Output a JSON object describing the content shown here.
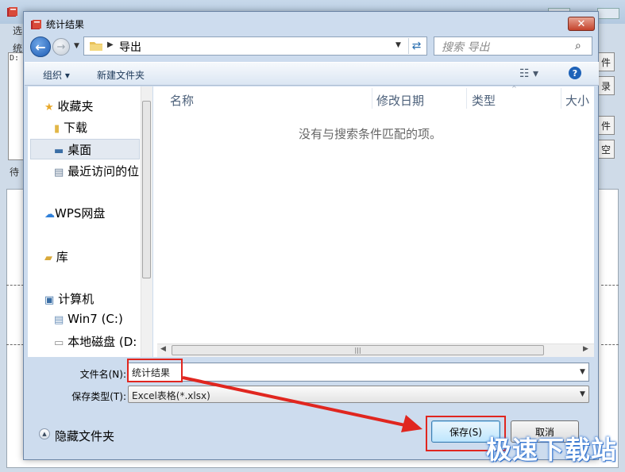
{
  "background_app": {
    "menu_label": "选",
    "side_tab": "统",
    "panel_text": "D:",
    "status_label": "待",
    "side_buttons": [
      "件",
      "录",
      "件",
      "空"
    ]
  },
  "dialog": {
    "title": "统计结果",
    "close_symbol": "✕"
  },
  "nav": {
    "back_symbol": "←",
    "forward_symbol": "→",
    "address_segment": "导出",
    "search_placeholder": "搜索 导出"
  },
  "toolbar": {
    "organize_label": "组织 ▾",
    "new_folder_label": "新建文件夹",
    "help_symbol": "?"
  },
  "nav_pane": {
    "favorites": "收藏夹",
    "downloads": "下载",
    "desktop": "桌面",
    "recent": "最近访问的位",
    "wps": "WPS网盘",
    "library": "库",
    "computer": "计算机",
    "drive_c": "Win7 (C:)",
    "drive_d": "本地磁盘 (D:"
  },
  "file_list": {
    "columns": [
      "名称",
      "修改日期",
      "类型",
      "大小"
    ],
    "empty_message": "没有与搜索条件匹配的项。"
  },
  "form": {
    "filename_label": "文件名(N):",
    "filename_value": "统计结果",
    "filetype_label": "保存类型(T):",
    "filetype_value": "Excel表格(*.xlsx)"
  },
  "footer": {
    "hide_folders_label": "隐藏文件夹",
    "save_label": "保存(S)",
    "cancel_label": "取消"
  },
  "watermark": "极速下载站",
  "colors": {
    "annotation_red": "#e0261f",
    "dialog_frame": "#cddcee",
    "accent_blue": "#1e62b8"
  }
}
